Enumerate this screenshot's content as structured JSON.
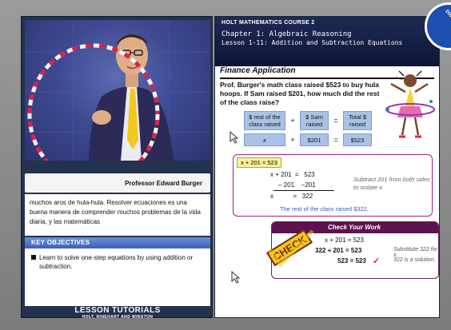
{
  "video": {
    "presenter_name": "Professor Edward Burger",
    "subtitle": "muchos aros de hula-hula. Resolver ecuaciones es una buena manera de comprender muchos problemas de la vida diaria, y las matemáticas"
  },
  "objectives": {
    "header": "KEY OBJECTIVES",
    "items": [
      "Learn to solve one-step equations by using addition or subtraction."
    ]
  },
  "footer_logo": {
    "title": "LESSON TUTORIALS",
    "publisher": "HOLT, RINEHART AND WINSTON"
  },
  "header": {
    "course": "HOLT MATHEMATICS COURSE 2",
    "chapter": "Chapter 1: Algebraic Reasoning",
    "lesson": "Lesson 1-11: Addition and Subtraction Equations",
    "badge": "DISTINGUIS"
  },
  "panel": {
    "title": "Finance Application",
    "problem": "Prof. Burger's math class raised $523 to buy hula hoops. If Sam raised $201, how much did the rest of the class raise?",
    "model": {
      "labels": [
        "$ rest of the class raised",
        "$ Sam raised",
        "Total $ raised"
      ],
      "ops": [
        "+",
        "="
      ],
      "values": [
        "x",
        "$201",
        "$523"
      ]
    },
    "work": {
      "equation": "x + 201 = 523",
      "line1": "x + 201  =   523",
      "line2": "– 201    –201",
      "line3": "x           =   322",
      "note": "Subtract 201 from both sides to isolate x.",
      "result": "The rest of the class raised $322."
    },
    "check": {
      "header": "Check Your Work",
      "stamp": "CHECK",
      "line1": "x + 201 = 523",
      "line2": "322 + 201 = 523",
      "line3": "523 = 523",
      "checkmark": "✓",
      "note1": "Substitute 322 for x.",
      "note2": "322 is a solution."
    }
  },
  "colors": {
    "accent_blue": "#3a62b8",
    "box_blue": "#a9c2e6",
    "work_border": "#a0247d",
    "check_header": "#5b1450",
    "result_blue": "#3b55c3"
  }
}
